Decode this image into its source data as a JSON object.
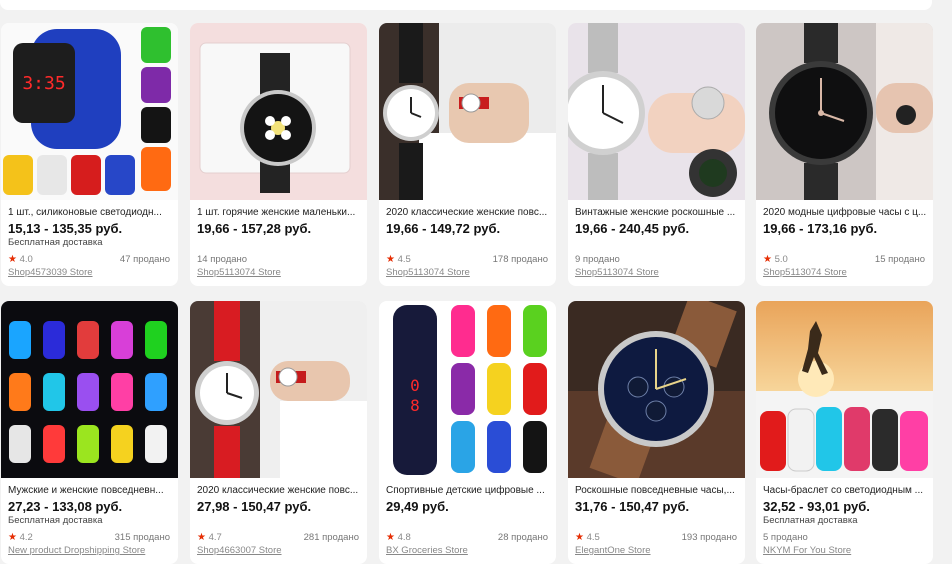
{
  "products": [
    {
      "title": "1 шт., силиконовые светодиодн...",
      "price": "15,13 - 135,35 руб.",
      "shipping": "Бесплатная доставка",
      "rating": "4.0",
      "sold": "47 продано",
      "store": "Shop4573039 Store"
    },
    {
      "title": "1 шт. горячие женские маленьки...",
      "price": "19,66 - 157,28 руб.",
      "shipping": "",
      "rating": "",
      "sold": "14 продано",
      "store": "Shop5113074 Store"
    },
    {
      "title": "2020 классические женские повс...",
      "price": "19,66 - 149,72 руб.",
      "shipping": "",
      "rating": "4.5",
      "sold": "178 продано",
      "store": "Shop5113074 Store"
    },
    {
      "title": "Винтажные женские роскошные ...",
      "price": "19,66 - 240,45 руб.",
      "shipping": "",
      "rating": "",
      "sold": "9 продано",
      "store": "Shop5113074 Store"
    },
    {
      "title": "2020 модные цифровые часы с ц...",
      "price": "19,66 - 173,16 руб.",
      "shipping": "",
      "rating": "5.0",
      "sold": "15 продано",
      "store": "Shop5113074 Store"
    },
    {
      "title": "Мужские и женские повседневн...",
      "price": "27,23 - 133,08 руб.",
      "shipping": "Бесплатная доставка",
      "rating": "4.2",
      "sold": "315 продано",
      "store": "New product Dropshipping Store"
    },
    {
      "title": "2020 классические женские повс...",
      "price": "27,98 - 150,47 руб.",
      "shipping": "",
      "rating": "4.7",
      "sold": "281 продано",
      "store": "Shop4663007 Store"
    },
    {
      "title": "Спортивные детские цифровые ...",
      "price": "29,49 руб.",
      "shipping": "",
      "rating": "4.8",
      "sold": "28 продано",
      "store": "BX Groceries Store"
    },
    {
      "title": "Роскошные повседневные часы,...",
      "price": "31,76 - 150,47 руб.",
      "shipping": "",
      "rating": "4.5",
      "sold": "193 продано",
      "store": "ElegantOne Store"
    },
    {
      "title": "Часы-браслет со светодиодным ...",
      "price": "32,52 - 93,01 руб.",
      "shipping": "Бесплатная доставка",
      "rating": "",
      "sold": "5 продано",
      "store": "NKYM For You Store"
    }
  ],
  "colors": {
    "star": "#e62e04",
    "card_bg": "#ffffff",
    "page_bg": "#f2f2f2"
  }
}
